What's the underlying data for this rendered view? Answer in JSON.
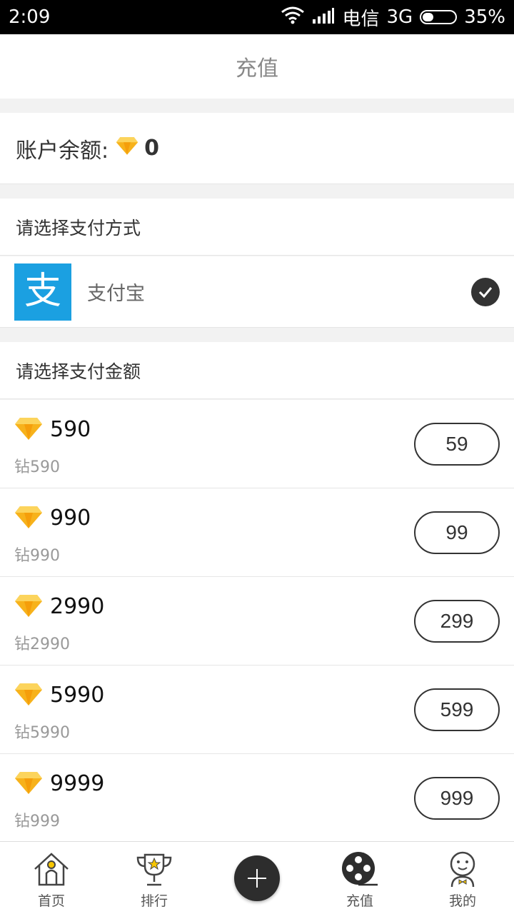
{
  "status_bar": {
    "time": "2:09",
    "carrier": "电信",
    "network": "3G",
    "battery": "35%",
    "battery_level": 0.35
  },
  "header": {
    "title": "充值"
  },
  "balance": {
    "label": "账户余额:",
    "value": "0"
  },
  "payment_method": {
    "heading": "请选择支付方式",
    "option": {
      "logo_char": "支",
      "name": "支付宝",
      "selected": true
    }
  },
  "amount_section": {
    "heading": "请选择支付金额"
  },
  "packages": [
    {
      "diamonds": "590",
      "sub": "钻590",
      "price": "59"
    },
    {
      "diamonds": "990",
      "sub": "钻990",
      "price": "99"
    },
    {
      "diamonds": "2990",
      "sub": "钻2990",
      "price": "299"
    },
    {
      "diamonds": "5990",
      "sub": "钻5990",
      "price": "599"
    },
    {
      "diamonds": "9999",
      "sub": "钻999",
      "price": "999"
    }
  ],
  "tabbar": {
    "items": [
      {
        "label": "首页",
        "icon": "home-icon"
      },
      {
        "label": "排行",
        "icon": "trophy-icon"
      },
      {
        "label": "",
        "icon": "plus-icon"
      },
      {
        "label": "充值",
        "icon": "reel-icon"
      },
      {
        "label": "我的",
        "icon": "profile-icon"
      }
    ]
  },
  "colors": {
    "accent": "#1ba0e1",
    "gem": "#f7b21b",
    "dark": "#2d2d2d"
  }
}
